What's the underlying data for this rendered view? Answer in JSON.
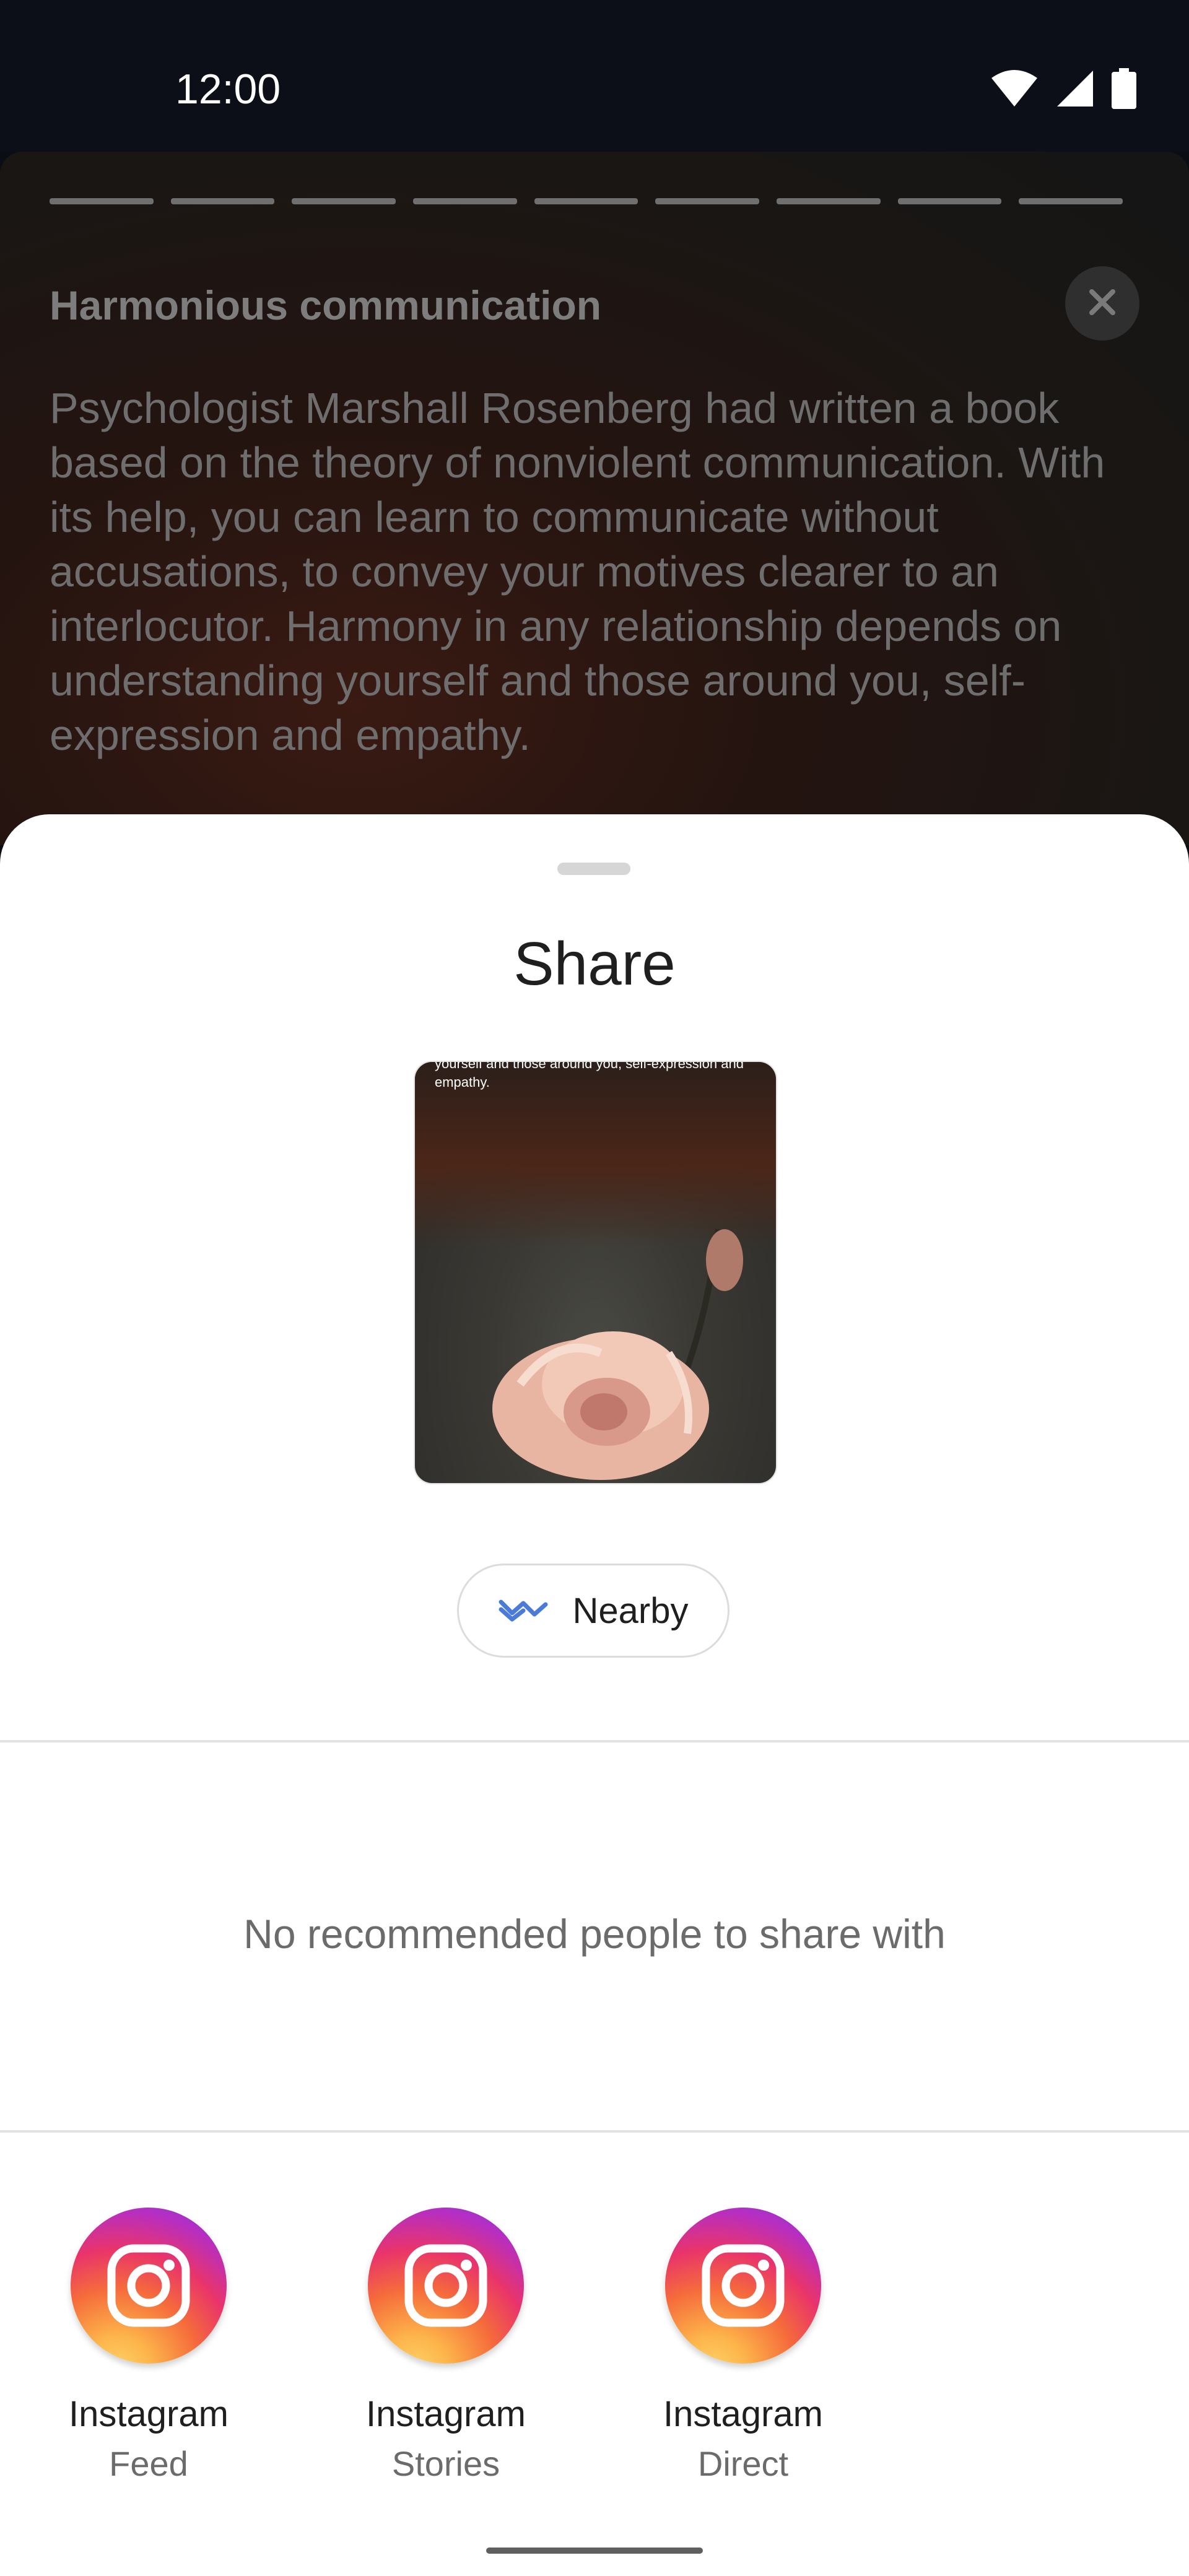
{
  "status_bar": {
    "time": "12:00",
    "icons": [
      "wifi-icon",
      "cell-signal-icon",
      "battery-icon"
    ]
  },
  "story": {
    "title": "Harmonious communication",
    "body": "Psychologist Marshall Rosenberg had written a book based on the theory of nonviolent communication. With its help, you can learn to communicate without accusations, to convey your motives clearer to an interlocutor. Harmony in any relationship depends on understanding yourself and those around you, self-expression and empathy.",
    "progress_segments": 9
  },
  "share_sheet": {
    "title": "Share",
    "preview_text": "yourself and those around you, self-expression and empathy.",
    "nearby_label": "Nearby",
    "no_recommendations": "No recommended people to share with",
    "apps": [
      {
        "name": "Instagram",
        "sub": "Feed"
      },
      {
        "name": "Instagram",
        "sub": "Stories"
      },
      {
        "name": "Instagram",
        "sub": "Direct"
      }
    ]
  },
  "colors": {
    "accent_nearby": "#4a7bd8",
    "instagram_gradient": [
      "#fdd46a",
      "#f56b3b",
      "#e9346a",
      "#b62ec2"
    ]
  }
}
